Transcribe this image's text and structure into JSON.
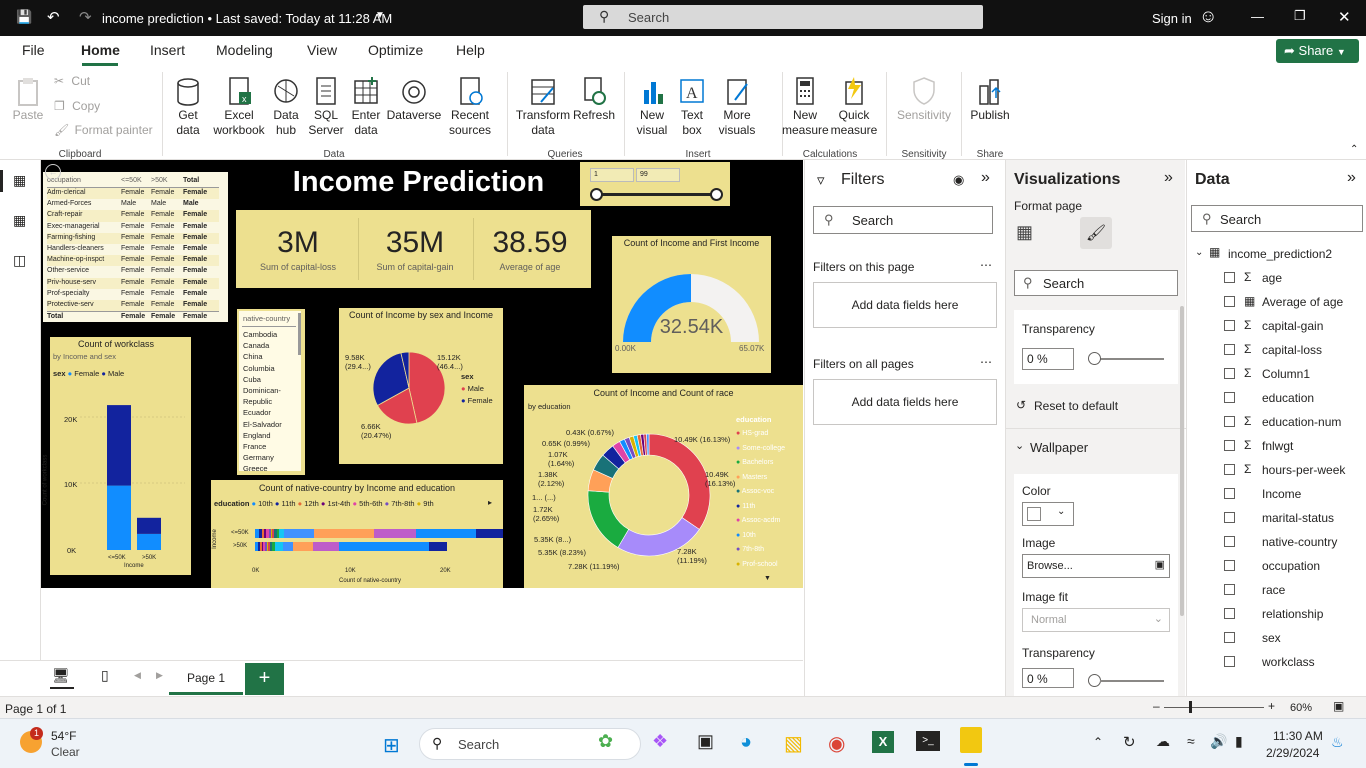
{
  "window": {
    "title": "income prediction • Last saved: Today at 11:28 AM",
    "search": "Search",
    "signin": "Sign in"
  },
  "menu": {
    "tabs": [
      "File",
      "Home",
      "Insert",
      "Modeling",
      "View",
      "Optimize",
      "Help"
    ],
    "share": "Share"
  },
  "ribbon": {
    "clipboard": {
      "paste": "Paste",
      "cut": "Cut",
      "copy": "Copy",
      "format_painter": "Format painter",
      "group": "Clipboard"
    },
    "data": {
      "get_data": "Get data",
      "excel": "Excel workbook",
      "data_hub": "Data hub",
      "sql": "SQL Server",
      "enter": "Enter data",
      "dataverse": "Dataverse",
      "recent": "Recent sources",
      "group": "Data"
    },
    "queries": {
      "transform": "Transform data",
      "refresh": "Refresh",
      "group": "Queries"
    },
    "insert": {
      "new_visual": "New visual",
      "text_box": "Text box",
      "more_visuals": "More visuals",
      "group": "Insert"
    },
    "calc": {
      "new_measure": "New measure",
      "quick_measure": "Quick measure",
      "group": "Calculations"
    },
    "sensitivity": {
      "label": "Sensitivity",
      "group": "Sensitivity"
    },
    "share": {
      "publish": "Publish",
      "group": "Share"
    }
  },
  "report": {
    "title": "Income Prediction",
    "slider": {
      "min": "1",
      "max": "99"
    },
    "kpis": [
      {
        "value": "3M",
        "label": "Sum of capital-loss"
      },
      {
        "value": "35M",
        "label": "Sum of capital-gain"
      },
      {
        "value": "38.59",
        "label": "Average of age"
      }
    ],
    "occ_table": {
      "headers": [
        "occupation",
        "<=50K",
        ">50K",
        "Total"
      ],
      "rows": [
        [
          "Adm-clerical",
          "Female",
          "Female",
          "Female"
        ],
        [
          "Armed-Forces",
          "Male",
          "Male",
          "Male"
        ],
        [
          "Craft-repair",
          "Female",
          "Female",
          "Female"
        ],
        [
          "Exec-managerial",
          "Female",
          "Female",
          "Female"
        ],
        [
          "Farming-fishing",
          "Female",
          "Female",
          "Female"
        ],
        [
          "Handlers-cleaners",
          "Female",
          "Female",
          "Female"
        ],
        [
          "Machine-op-inspct",
          "Female",
          "Female",
          "Female"
        ],
        [
          "Other-service",
          "Female",
          "Female",
          "Female"
        ],
        [
          "Priv-house-serv",
          "Female",
          "Female",
          "Female"
        ],
        [
          "Prof-specialty",
          "Female",
          "Female",
          "Female"
        ],
        [
          "Protective-serv",
          "Female",
          "Female",
          "Female"
        ]
      ],
      "total": [
        "Total",
        "Female",
        "Female",
        "Female"
      ]
    },
    "country_slicer": {
      "header": "native-country",
      "items": [
        "Cambodia",
        "Canada",
        "China",
        "Columbia",
        "Cuba",
        "Dominican-Republic",
        "Ecuador",
        "El-Salvador",
        "England",
        "France",
        "Germany",
        "Greece"
      ]
    },
    "gauge": {
      "title": "Count of Income and First Income",
      "value": "32.54K",
      "min": "0.00K",
      "max": "65.07K"
    },
    "pie": {
      "title": "Count of Income by sex and Income",
      "legend_title": "sex",
      "labels": [
        "15.12K (46.4...)",
        "9.58K (29.4...)",
        "6.66K (20.47%)"
      ]
    },
    "workclass": {
      "title": "Count of workclass",
      "subtitle": "by Income and sex",
      "legend_title": "sex",
      "ylabel": "Count of workclass",
      "xlabel": "Income",
      "yticks": [
        "20K",
        "10K",
        "0K"
      ]
    },
    "country_bar": {
      "title": "Count of native-country by Income and education",
      "legend_title": "education",
      "legend": [
        "10th",
        "11th",
        "12th",
        "1st-4th",
        "5th-6th",
        "7th-8th",
        "9th"
      ],
      "ylabel": "Income",
      "xlabel": "Count of native-country",
      "xticks": [
        "0K",
        "10K",
        "20K"
      ]
    },
    "donut": {
      "title": "Count of Income and Count of race",
      "subtitle": "by education",
      "legend_title": "education",
      "legend": [
        "HS-grad",
        "Some-college",
        "Bachelors",
        "Masters",
        "Assoc-voc",
        "11th",
        "Assoc-acdm",
        "10th",
        "7th-8th",
        "Prof-school"
      ],
      "labels": [
        "0.43K (0.67%)",
        "0.65K (0.99%)",
        "1.07K (1.64%)",
        "1.38K (2.12%)",
        "1... (...)",
        "1.72K (2.65%)",
        "5.35K (8...)",
        "5.35K (8.23%)",
        "7.28K (11.19%)",
        "7.28K (11.19%)",
        "10.49K (16.13%)",
        "10.49K (16.13%)"
      ]
    }
  },
  "chart_data": [
    {
      "type": "bar",
      "title": "Count of workclass",
      "categories": [
        "<=50K",
        ">50K"
      ],
      "series": [
        {
          "name": "Female",
          "values": [
            10000,
            2500
          ]
        },
        {
          "name": "Male",
          "values": [
            22500,
            5000
          ]
        }
      ],
      "ylim": [
        0,
        25000
      ]
    },
    {
      "type": "pie",
      "title": "Count of Income by sex and Income",
      "series": [
        {
          "name": "Male",
          "values": [
            15120,
            6660
          ]
        },
        {
          "name": "Female",
          "values": [
            9580,
            1170
          ]
        }
      ]
    },
    {
      "type": "pie",
      "title": "Count of Income and Count of race",
      "categories": [
        "HS-grad",
        "Some-college",
        "Bachelors",
        "Masters",
        "Assoc-voc",
        "11th",
        "Assoc-acdm",
        "10th",
        "7th-8th",
        "Prof-school"
      ],
      "values": [
        10490,
        7280,
        5350,
        1720,
        1380,
        1070,
        650,
        430,
        400,
        350
      ]
    },
    {
      "type": "bar",
      "title": "Count of native-country by Income and education",
      "categories": [
        "<=50K",
        ">50K"
      ],
      "xlim": [
        0,
        25000
      ]
    }
  ],
  "filters": {
    "title": "Filters",
    "search": "Search",
    "on_page": "Filters on this page",
    "on_all": "Filters on all pages",
    "add": "Add data fields here"
  },
  "viz": {
    "title": "Visualizations",
    "format_page": "Format page",
    "search": "Search",
    "transparency": "Transparency",
    "pct": "0 %",
    "reset": "Reset to default",
    "wallpaper": "Wallpaper",
    "color": "Color",
    "image": "Image",
    "browse": "Browse...",
    "image_fit": "Image fit",
    "fit_value": "Normal",
    "transparency2": "Transparency",
    "pct2": "0 %"
  },
  "data": {
    "title": "Data",
    "search": "Search",
    "table": "income_prediction2",
    "fields": [
      {
        "name": "age",
        "icon": "sigma"
      },
      {
        "name": "Average of age",
        "icon": "calc"
      },
      {
        "name": "capital-gain",
        "icon": "sigma"
      },
      {
        "name": "capital-loss",
        "icon": "sigma"
      },
      {
        "name": "Column1",
        "icon": "sigma"
      },
      {
        "name": "education",
        "icon": ""
      },
      {
        "name": "education-num",
        "icon": "sigma"
      },
      {
        "name": "fnlwgt",
        "icon": "sigma"
      },
      {
        "name": "hours-per-week",
        "icon": "sigma"
      },
      {
        "name": "Income",
        "icon": ""
      },
      {
        "name": "marital-status",
        "icon": ""
      },
      {
        "name": "native-country",
        "icon": ""
      },
      {
        "name": "occupation",
        "icon": ""
      },
      {
        "name": "race",
        "icon": ""
      },
      {
        "name": "relationship",
        "icon": ""
      },
      {
        "name": "sex",
        "icon": ""
      },
      {
        "name": "workclass",
        "icon": ""
      }
    ]
  },
  "tabs": {
    "page1": "Page 1"
  },
  "status": {
    "page": "Page 1 of 1",
    "zoom": "60%"
  },
  "taskbar": {
    "temp": "54°F",
    "weather": "Clear",
    "search": "Search",
    "time": "11:30 AM",
    "date": "2/29/2024",
    "badge": "1"
  },
  "colors": {
    "male": "#e0414f",
    "female": "#12239e",
    "accent": "#217346",
    "report_bg": "#000000",
    "card": "#ede08f"
  }
}
